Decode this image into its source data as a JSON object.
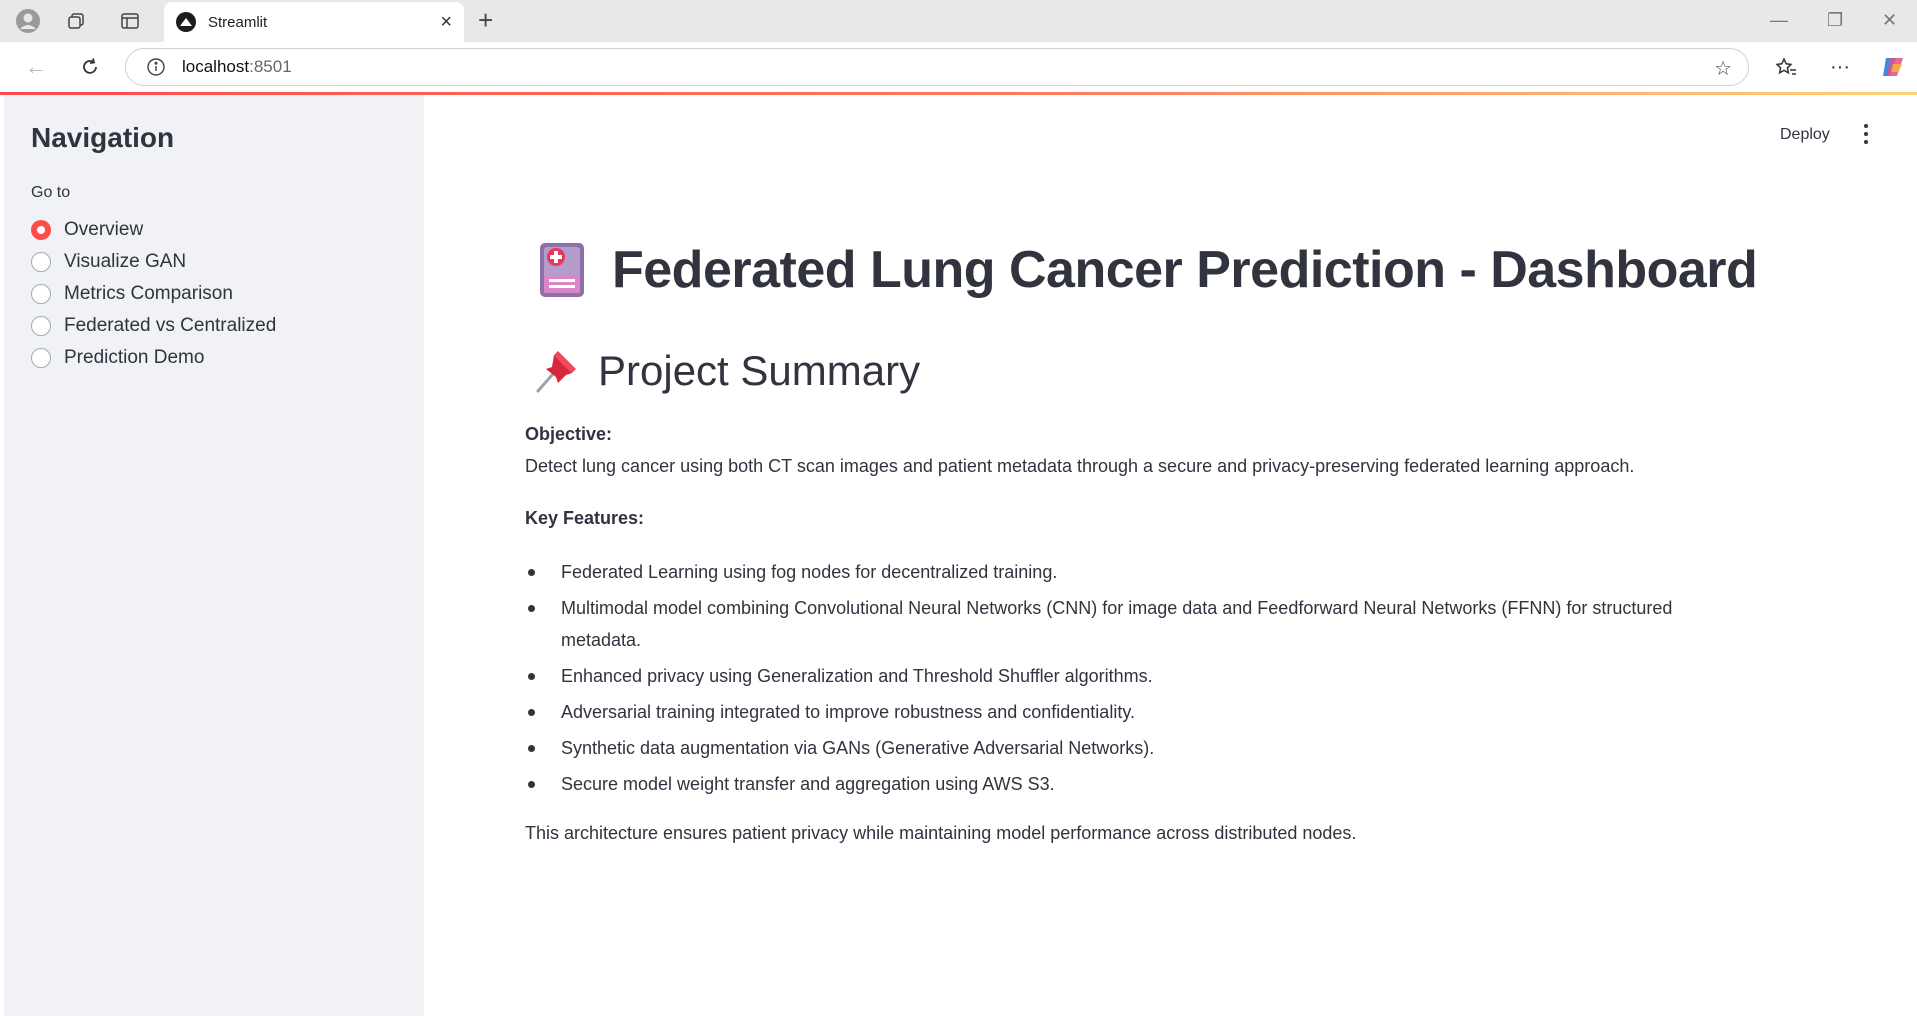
{
  "browser": {
    "tab_title": "Streamlit",
    "url_host": "localhost",
    "url_port": ":8501"
  },
  "sidebar": {
    "title": "Navigation",
    "radio_label": "Go to",
    "options": [
      "Overview",
      "Visualize GAN",
      "Metrics Comparison",
      "Federated vs Centralized",
      "Prediction Demo"
    ],
    "selected": "Overview"
  },
  "toolbar": {
    "deploy_label": "Deploy"
  },
  "main": {
    "title": "Federated Lung Cancer Prediction - Dashboard",
    "title_icon": "hospital-document-icon",
    "section_title": "Project Summary",
    "section_icon": "pushpin-icon",
    "objective_label": "Objective:",
    "objective_text": "Detect lung cancer using both CT scan images and patient metadata through a secure and privacy-preserving federated learning approach.",
    "features_label": "Key Features:",
    "features": [
      "Federated Learning using fog nodes for decentralized training.",
      "Multimodal model combining Convolutional Neural Networks (CNN) for image data and Feedforward Neural Networks (FFNN) for structured metadata.",
      "Enhanced privacy using Generalization and Threshold Shuffler algorithms.",
      "Adversarial training integrated to improve robustness and confidentiality.",
      "Synthetic data augmentation via GANs (Generative Adversarial Networks).",
      "Secure model weight transfer and aggregation using AWS S3."
    ],
    "closing_text": "This architecture ensures patient privacy while maintaining model performance across distributed nodes."
  },
  "colors": {
    "accent": "#ff4b4b",
    "sidebar_bg": "#f0f2f6",
    "text": "#31333f"
  }
}
